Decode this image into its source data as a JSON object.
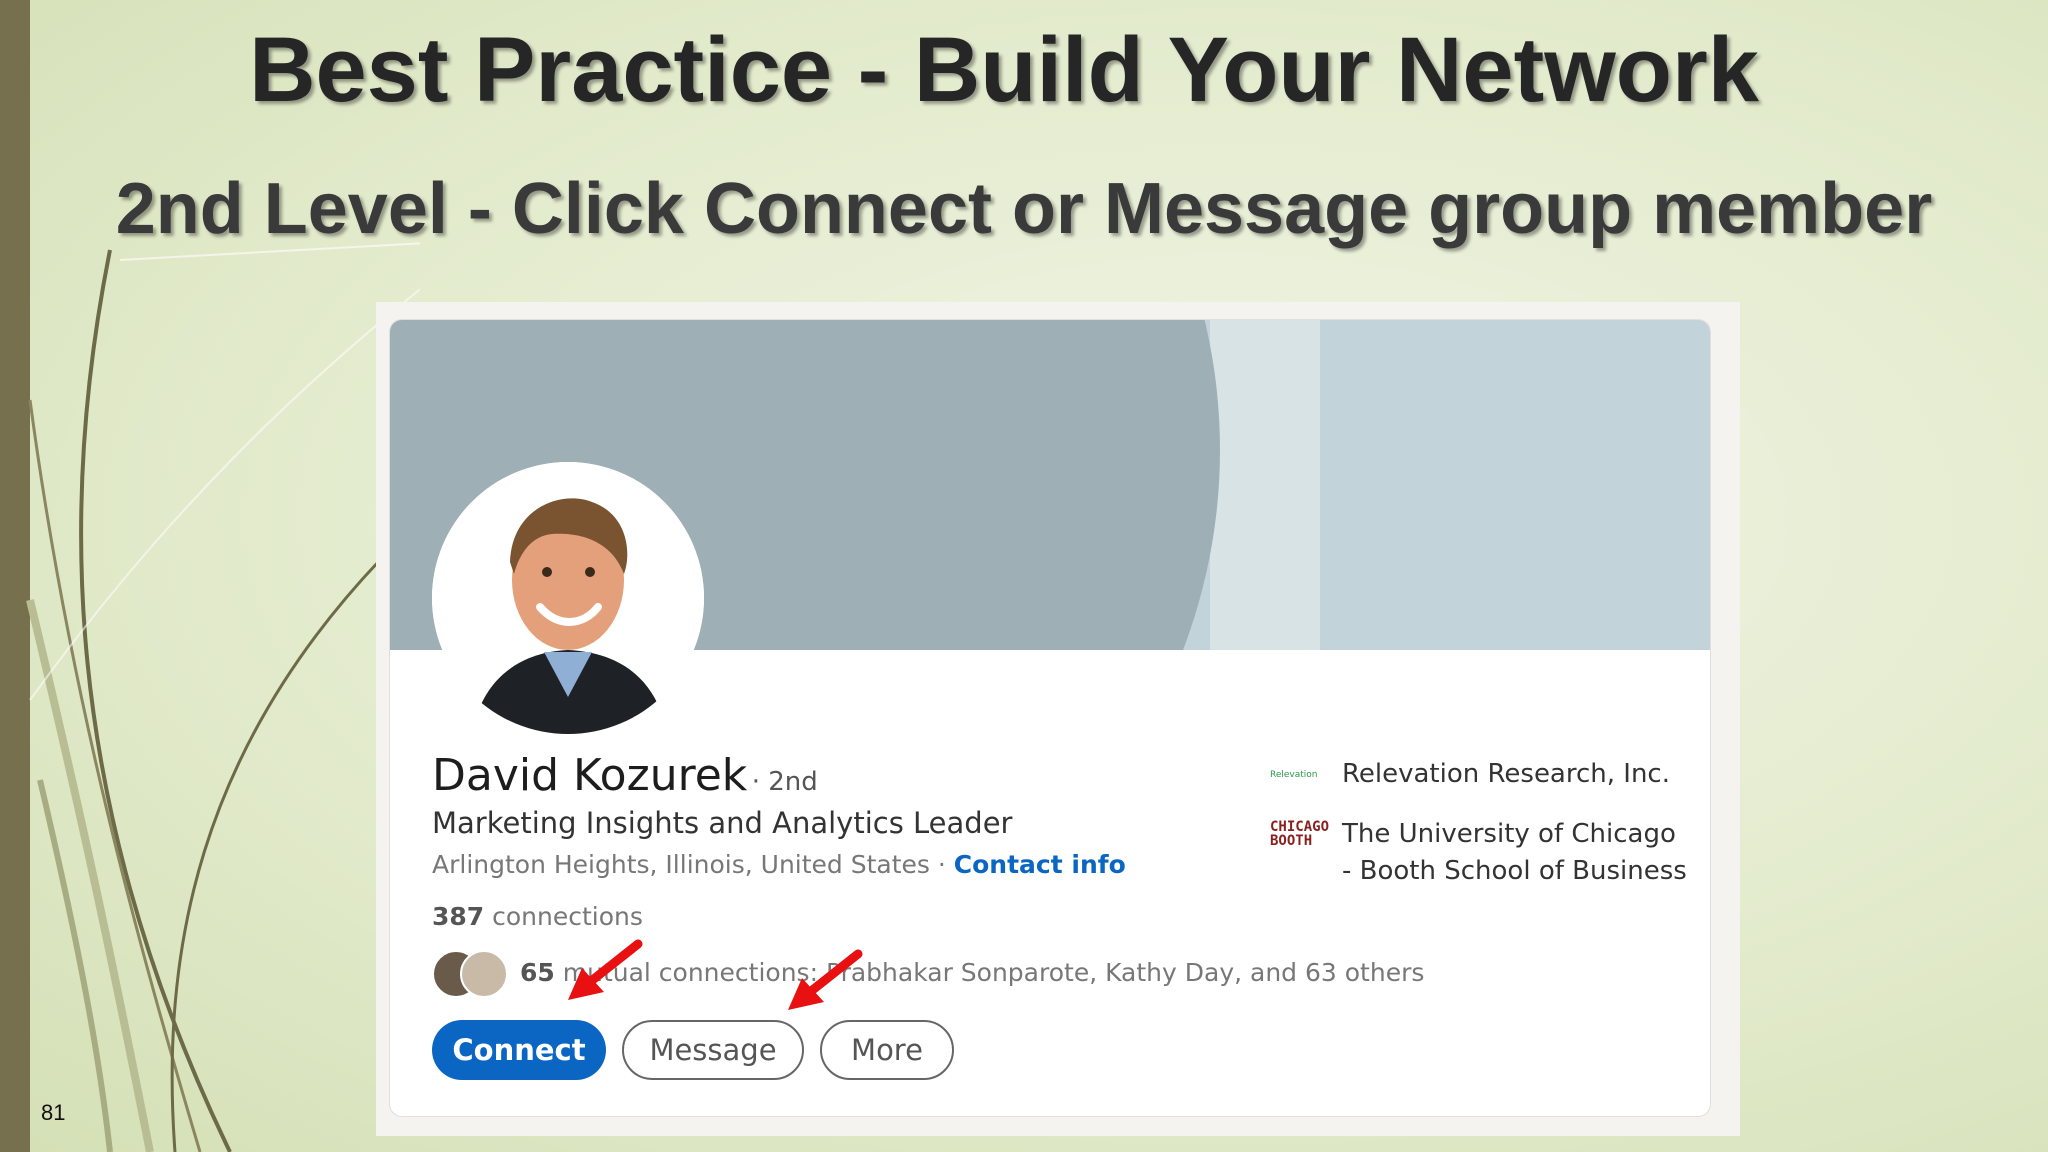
{
  "slide": {
    "title": "Best Practice - Build Your Network",
    "subtitle": "2nd Level - Click Connect or Message group member",
    "page_number": "81"
  },
  "profile": {
    "name": "David Kozurek",
    "degree": "· 2nd",
    "headline": "Marketing Insights and Analytics Leader",
    "location": "Arlington Heights, Illinois, United States · ",
    "contact_link": "Contact info",
    "connections_count": "387",
    "connections_label": " connections",
    "mutual_count": "65",
    "mutual_text": " mutual connections: Prabhakar Sonparote, Kathy Day, and 63 others",
    "organizations": [
      {
        "name": "Relevation Research, Inc.",
        "logo_text": "Relevation"
      },
      {
        "name_line1": "The University of Chicago",
        "name_line2": "- Booth School of Business",
        "logo_text_1": "CHICAGO",
        "logo_text_2": "BOOTH"
      }
    ]
  },
  "actions": {
    "connect": "Connect",
    "message": "Message",
    "more": "More"
  },
  "colors": {
    "primary_blue": "#0a66c2",
    "arrow_red": "#e81010",
    "left_bar": "#77704f"
  }
}
